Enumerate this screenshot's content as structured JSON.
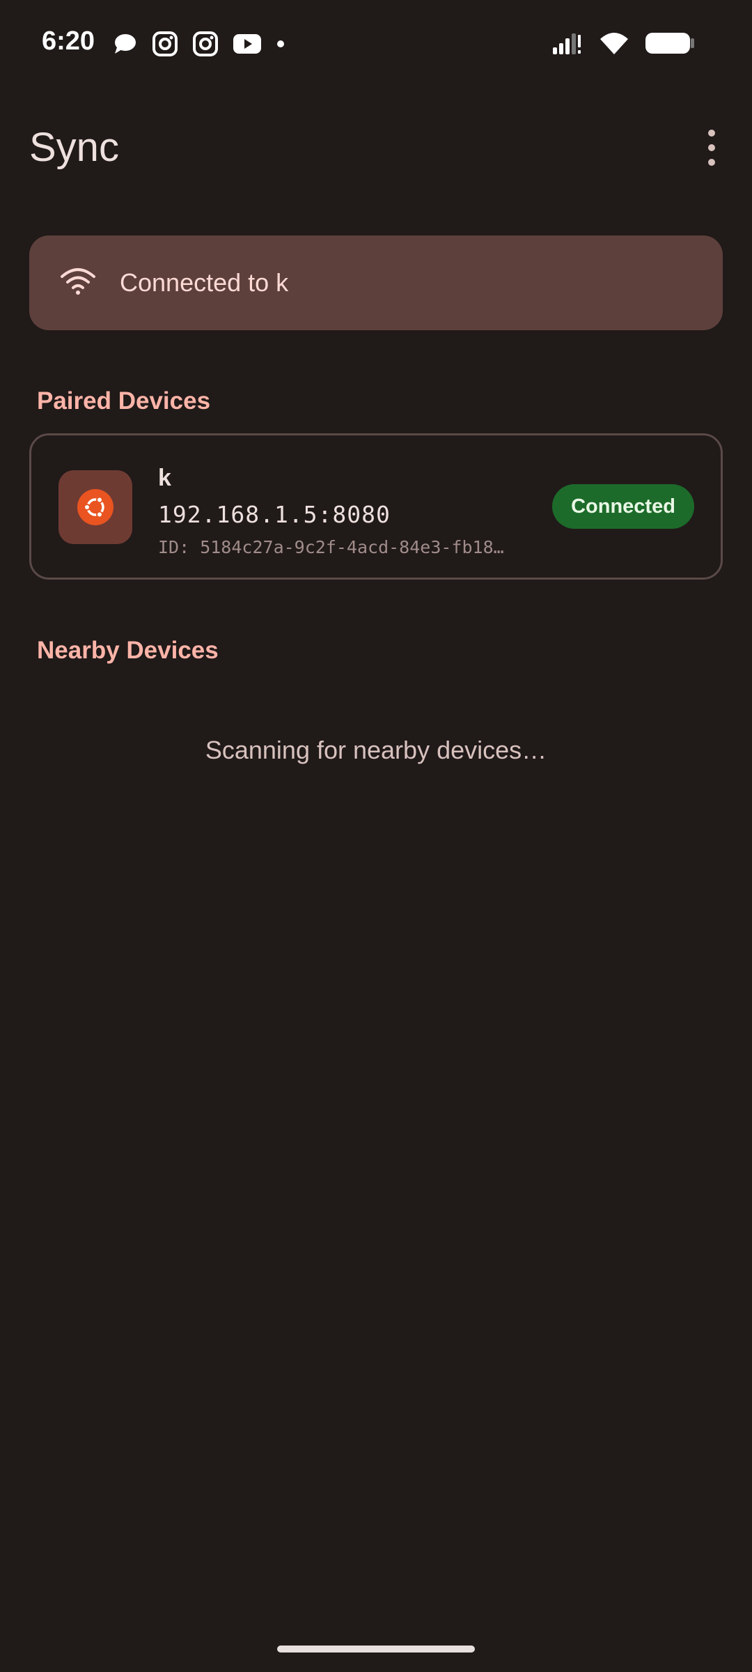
{
  "status_bar": {
    "time": "6:20",
    "notification_icons": [
      "threads-icon",
      "instagram-icon",
      "instagram-icon",
      "youtube-icon",
      "dot-icon"
    ],
    "system_icons": [
      "signal-icon",
      "wifi-icon",
      "battery-icon"
    ]
  },
  "app_bar": {
    "title": "Sync",
    "menu_icon": "more-vert-icon"
  },
  "connection_banner": {
    "icon": "wifi-icon",
    "text": "Connected to k"
  },
  "paired_devices": {
    "header": "Paired Devices",
    "devices": [
      {
        "icon": "ubuntu-icon",
        "name": "k",
        "address": "192.168.1.5:8080",
        "id": "ID: 5184c27a-9c2f-4acd-84e3-fb18…",
        "status": "Connected"
      }
    ]
  },
  "nearby_devices": {
    "header": "Nearby Devices",
    "empty_text": "Scanning for nearby devices…"
  },
  "colors": {
    "background": "#201a19",
    "banner": "#5d403c",
    "accent": "#ffb4a8",
    "status_connected": "#1d6b2a",
    "ubuntu_orange": "#e95420"
  }
}
